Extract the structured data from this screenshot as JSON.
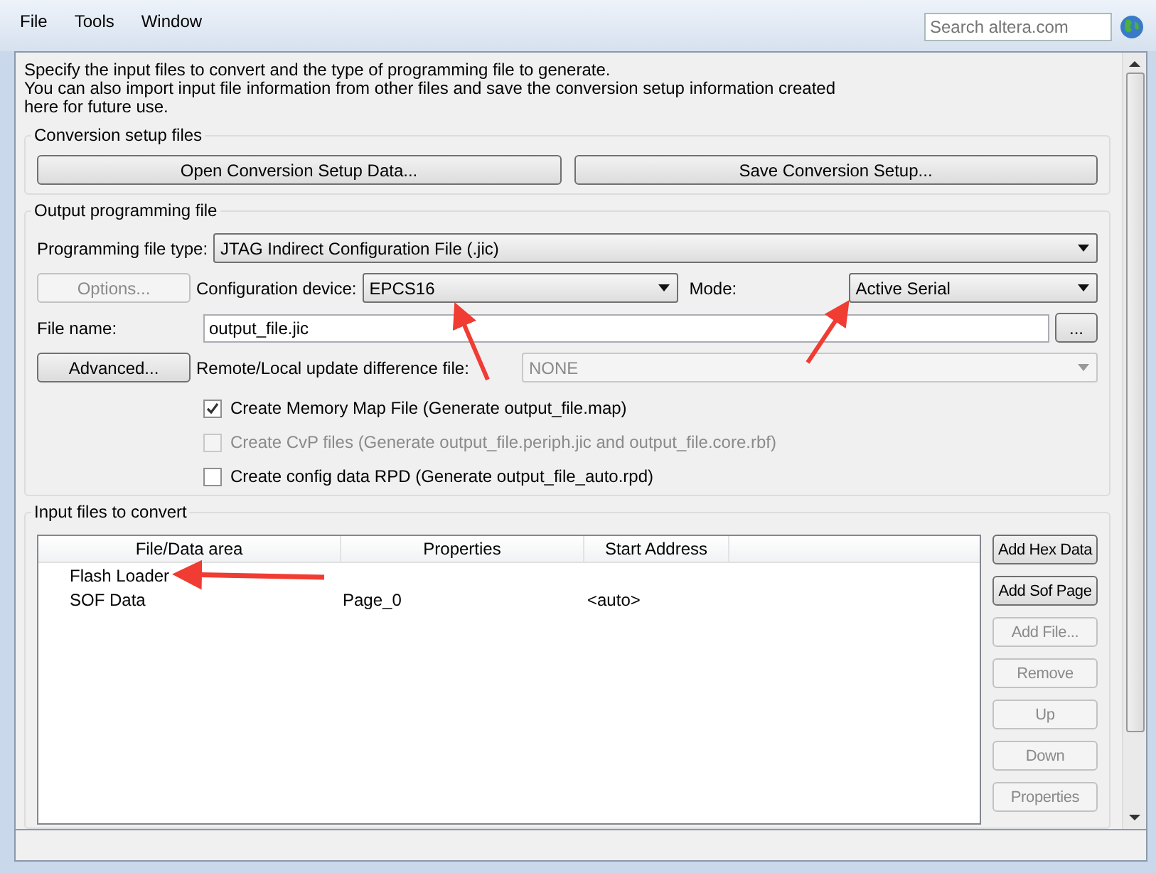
{
  "menu": [
    "File",
    "Tools",
    "Window"
  ],
  "search": {
    "placeholder": "Search altera.com"
  },
  "intro": [
    "Specify the input files to convert and the type of programming file to generate.",
    "You can also import input file information from other files and save the conversion setup information created here for future use."
  ],
  "conversion_setup": {
    "title": "Conversion setup files",
    "buttons": [
      {
        "label": "Open Conversion Setup Data...",
        "disabled": false
      },
      {
        "label": "Save Conversion Setup...",
        "disabled": false
      }
    ]
  },
  "output": {
    "title": "Output programming file",
    "file_type": {
      "label": "Programming file type:",
      "value": "JTAG Indirect Configuration File (.jic)",
      "disabled": false
    },
    "options_button": {
      "label": "Options...",
      "disabled": true
    },
    "device": {
      "label": "Configuration device:",
      "value": "EPCS16",
      "disabled": false
    },
    "mode": {
      "label": "Mode:",
      "value": "Active Serial",
      "disabled": false
    },
    "file_name": {
      "label": "File name:",
      "value": "output_file.jic",
      "browse": "..."
    },
    "advanced_button": {
      "label": "Advanced...",
      "disabled": false
    },
    "remote": {
      "label": "Remote/Local update difference file:",
      "value": "NONE",
      "disabled": true
    },
    "checkboxes": [
      {
        "label": "Create Memory Map File (Generate output_file.map)",
        "checked": true,
        "disabled": false
      },
      {
        "label": "Create CvP files (Generate output_file.periph.jic and output_file.core.rbf)",
        "checked": false,
        "disabled": true
      },
      {
        "label": "Create config data RPD (Generate output_file_auto.rpd)",
        "checked": false,
        "disabled": false
      }
    ]
  },
  "input": {
    "title": "Input files to convert",
    "table": {
      "columns": [
        "File/Data area",
        "Properties",
        "Start Address"
      ],
      "rows": [
        {
          "cells": [
            "Flash Loader",
            "",
            ""
          ]
        },
        {
          "cells": [
            "SOF Data",
            "Page_0",
            "<auto>"
          ]
        }
      ]
    },
    "buttons": [
      {
        "label": "Add Hex Data",
        "disabled": false
      },
      {
        "label": "Add Sof Page",
        "disabled": false
      },
      {
        "label": "Add File...",
        "disabled": true
      },
      {
        "label": "Remove",
        "disabled": true
      },
      {
        "label": "Up",
        "disabled": true
      },
      {
        "label": "Down",
        "disabled": true
      },
      {
        "label": "Properties",
        "disabled": true
      }
    ]
  }
}
